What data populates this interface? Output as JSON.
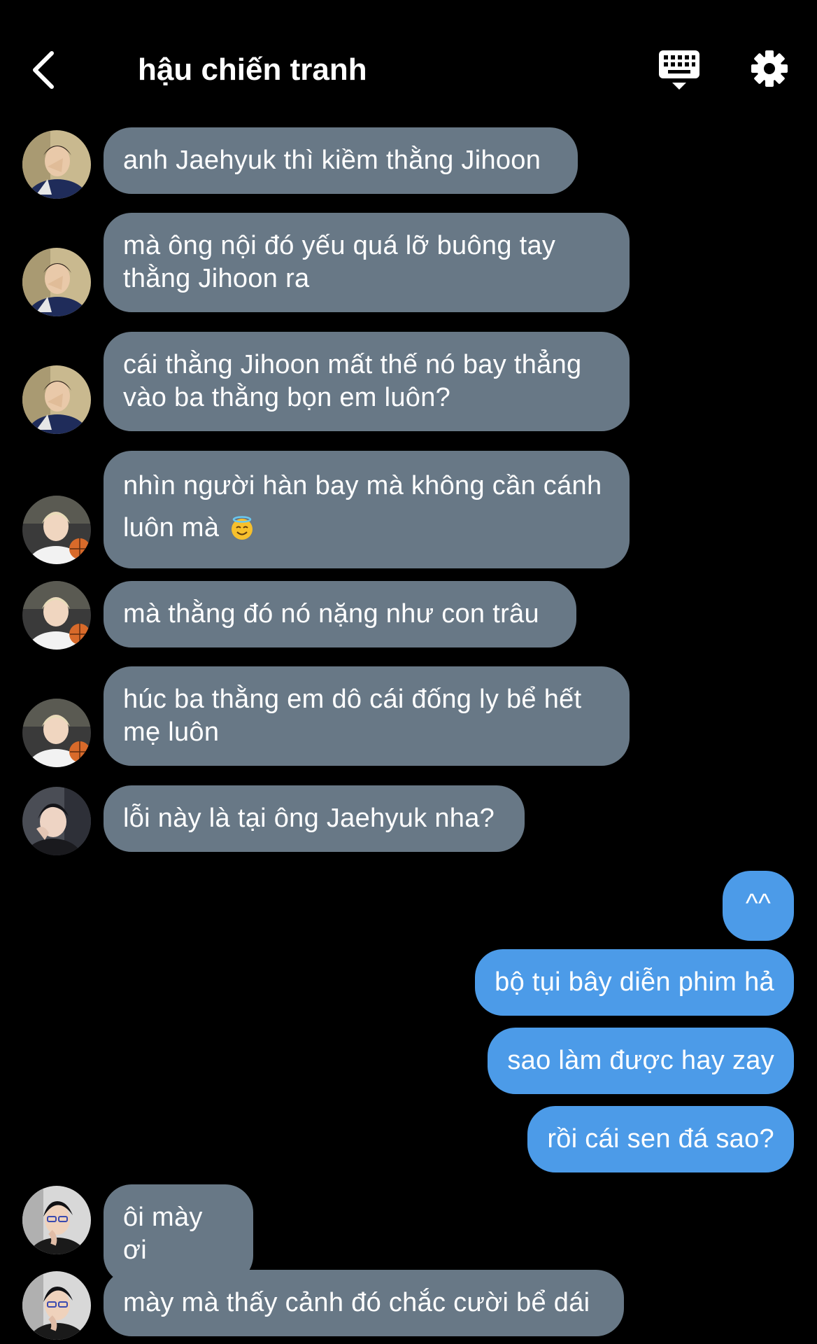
{
  "header": {
    "title": "hậu chiến tranh"
  },
  "messages": [
    {
      "text": "anh Jaehyuk thì kiềm thằng Jihoon",
      "direction": "in",
      "sender_avatar": "avatar-a"
    },
    {
      "text": "mà ông nội đó yếu quá lỡ buông tay thằng Jihoon ra",
      "direction": "in",
      "sender_avatar": "avatar-a"
    },
    {
      "text": "cái thằng Jihoon mất thế nó bay thẳng vào ba thằng bọn em luôn?",
      "direction": "in",
      "sender_avatar": "avatar-a"
    },
    {
      "text": "nhìn người hàn bay mà không cần cánh luôn mà",
      "emoji": "smiling-face-with-halo-emoji",
      "direction": "in",
      "sender_avatar": "avatar-b"
    },
    {
      "text": "mà thằng đó nó nặng như con trâu",
      "direction": "in",
      "sender_avatar": "avatar-b"
    },
    {
      "text": "húc ba thằng em dô cái đống ly bể hết mẹ luôn",
      "direction": "in",
      "sender_avatar": "avatar-b"
    },
    {
      "text": "lỗi này là tại ông Jaehyuk nha?",
      "direction": "in",
      "sender_avatar": "avatar-c"
    },
    {
      "text": "^^",
      "direction": "out"
    },
    {
      "text": "bộ tụi bây diễn phim hả",
      "direction": "out"
    },
    {
      "text": "sao làm được hay zay",
      "direction": "out"
    },
    {
      "text": "rồi cái sen đá sao?",
      "direction": "out"
    },
    {
      "text": "ôi mày ơi",
      "direction": "in",
      "sender_avatar": "avatar-d"
    },
    {
      "text": "mày mà thấy cảnh đó chắc cười bể dái",
      "direction": "in",
      "sender_avatar": "avatar-d"
    }
  ],
  "colors": {
    "background": "#000000",
    "incoming_bubble": "#687886",
    "outgoing_bubble": "#4c9be8",
    "text": "#ffffff"
  },
  "icons": {
    "back": "chevron-left-icon",
    "keyboard": "keyboard-icon",
    "settings": "gear-icon"
  }
}
